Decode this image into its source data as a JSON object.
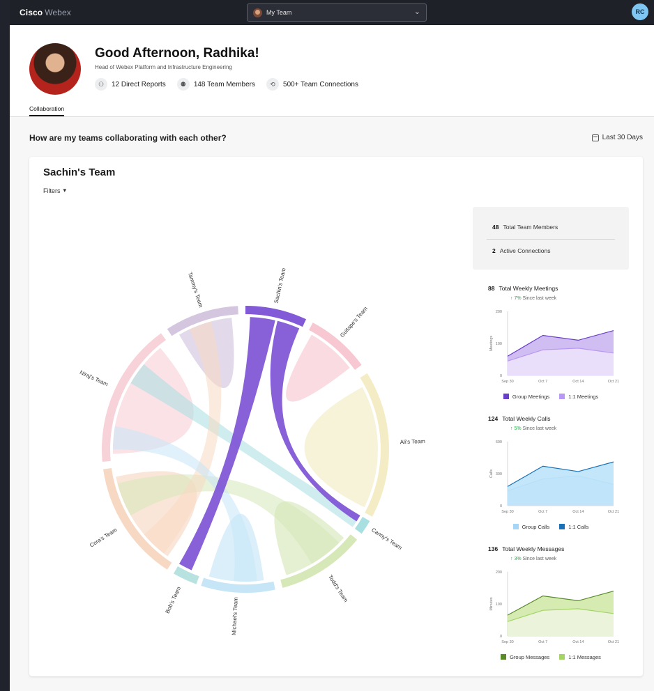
{
  "app": {
    "brand": "Cisco",
    "brand_sub": "Webex",
    "team_selector": "My Team",
    "user_initials": "RC"
  },
  "profile": {
    "greeting": "Good Afternoon, Radhika!",
    "role": "Head of Webex Platform and Infrastructure Engineering",
    "stats": [
      "12 Direct Reports",
      "148 Team Members",
      "500+ Team Connections"
    ]
  },
  "tabs": [
    "Collaboration"
  ],
  "section": {
    "question": "How are my teams collaborating with each other?",
    "range": "Last 30 Days"
  },
  "card": {
    "title": "Sachin's Team",
    "filters": "Filters"
  },
  "summary": {
    "members_value": "48",
    "members_label": "Total Team Members",
    "connections_value": "2",
    "connections_label": "Active Connections"
  },
  "chord_teams": [
    {
      "name": "Sachin's Team",
      "color": "#8d6ad9"
    },
    {
      "name": "Guitape's Team",
      "color": "#f7c7d2"
    },
    {
      "name": "Ali's Team",
      "color": "#f3ecc4"
    },
    {
      "name": "Canny's Team",
      "color": "#a8dfe0"
    },
    {
      "name": "Todd's Team",
      "color": "#d6e8b8"
    },
    {
      "name": "Michael's Team",
      "color": "#c6e6f7"
    },
    {
      "name": "Bob's Team",
      "color": "#b8e2df"
    },
    {
      "name": "Cora's Team",
      "color": "#f7d8c3"
    },
    {
      "name": "Niraj's Team",
      "color": "#f7d3d9"
    },
    {
      "name": "Tammy's Team",
      "color": "#d3c6de"
    }
  ],
  "chart_data": [
    {
      "type": "area",
      "stat_value": "88",
      "title": "Total Weekly Meetings",
      "trend_value": "7%",
      "trend_text": "Since last week",
      "ylabel": "Meetings",
      "ylim": [
        0,
        200
      ],
      "yticks": [
        "200",
        "100",
        "0"
      ],
      "categories": [
        "Sep 30",
        "Oct 7",
        "Oct 14",
        "Oct 21"
      ],
      "series": [
        {
          "name": "Group Meetings",
          "color": "#6a3fc8",
          "fill": "#c8b2f0",
          "values": [
            60,
            125,
            110,
            140
          ]
        },
        {
          "name": "1:1 Meetings",
          "color": "#b997f5",
          "fill": "#efe5fd",
          "values": [
            45,
            80,
            85,
            70
          ]
        }
      ]
    },
    {
      "type": "area",
      "stat_value": "124",
      "title": "Total Weekly Calls",
      "trend_value": "5%",
      "trend_text": "Since last week",
      "ylabel": "Calls",
      "ylim": [
        0,
        600
      ],
      "yticks": [
        "600",
        "300",
        "0"
      ],
      "categories": [
        "Sep 30",
        "Oct 7",
        "Oct 14",
        "Oct 21"
      ],
      "series": [
        {
          "name": "Group Calls",
          "color": "#a5d6f5",
          "fill": "#e4f3fc",
          "values": [
            140,
            250,
            280,
            200
          ]
        },
        {
          "name": "1:1 Calls",
          "color": "#1a71b8",
          "fill": "#b9e2f9",
          "values": [
            180,
            370,
            320,
            410
          ]
        }
      ]
    },
    {
      "type": "area",
      "stat_value": "136",
      "title": "Total Weekly Messages",
      "trend_value": "3%",
      "trend_text": "Since last week",
      "ylabel": "Minutes",
      "ylim": [
        0,
        200
      ],
      "yticks": [
        "200",
        "100",
        "0"
      ],
      "categories": [
        "Sep 30",
        "Oct 7",
        "Oct 14",
        "Oct 21"
      ],
      "series": [
        {
          "name": "Group Messages",
          "color": "#5a8a2a",
          "fill": "#cfe8a4",
          "values": [
            65,
            125,
            110,
            140
          ]
        },
        {
          "name": "1:1 Messages",
          "color": "#a3d465",
          "fill": "#eef6e2",
          "values": [
            45,
            80,
            85,
            70
          ]
        }
      ]
    }
  ]
}
